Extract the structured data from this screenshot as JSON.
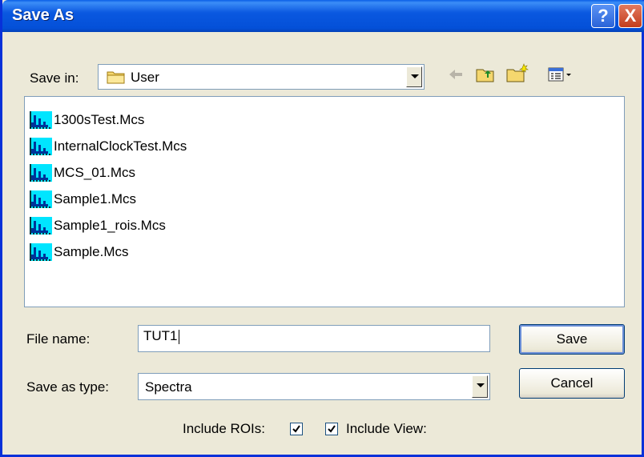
{
  "dialog": {
    "title": "Save As",
    "help_label": "?",
    "close_label": "X"
  },
  "save_in": {
    "label": "Save in:",
    "value": "User"
  },
  "files": [
    {
      "name": "1300sTest.Mcs"
    },
    {
      "name": "InternalClockTest.Mcs"
    },
    {
      "name": "MCS_01.Mcs"
    },
    {
      "name": "Sample1.Mcs"
    },
    {
      "name": "Sample1_rois.Mcs"
    },
    {
      "name": "Sample.Mcs"
    }
  ],
  "file_name": {
    "label": "File name:",
    "value": "TUT1"
  },
  "save_as_type": {
    "label": "Save as type:",
    "value": "Spectra"
  },
  "buttons": {
    "save": "Save",
    "cancel": "Cancel"
  },
  "options": {
    "include_rois_label": "Include ROIs:",
    "include_rois_checked": true,
    "include_view_label": "Include View:",
    "include_view_checked": true
  },
  "icons": {
    "folder": "folder-icon",
    "back": "back-arrow-icon",
    "up": "up-folder-icon",
    "new_folder": "new-folder-icon",
    "views": "views-menu-icon",
    "file": "mcs-file-icon"
  },
  "colors": {
    "titlebar": "#0a58e0",
    "dialog_bg": "#ece9d8",
    "file_icon_bg": "#00e5ff"
  }
}
